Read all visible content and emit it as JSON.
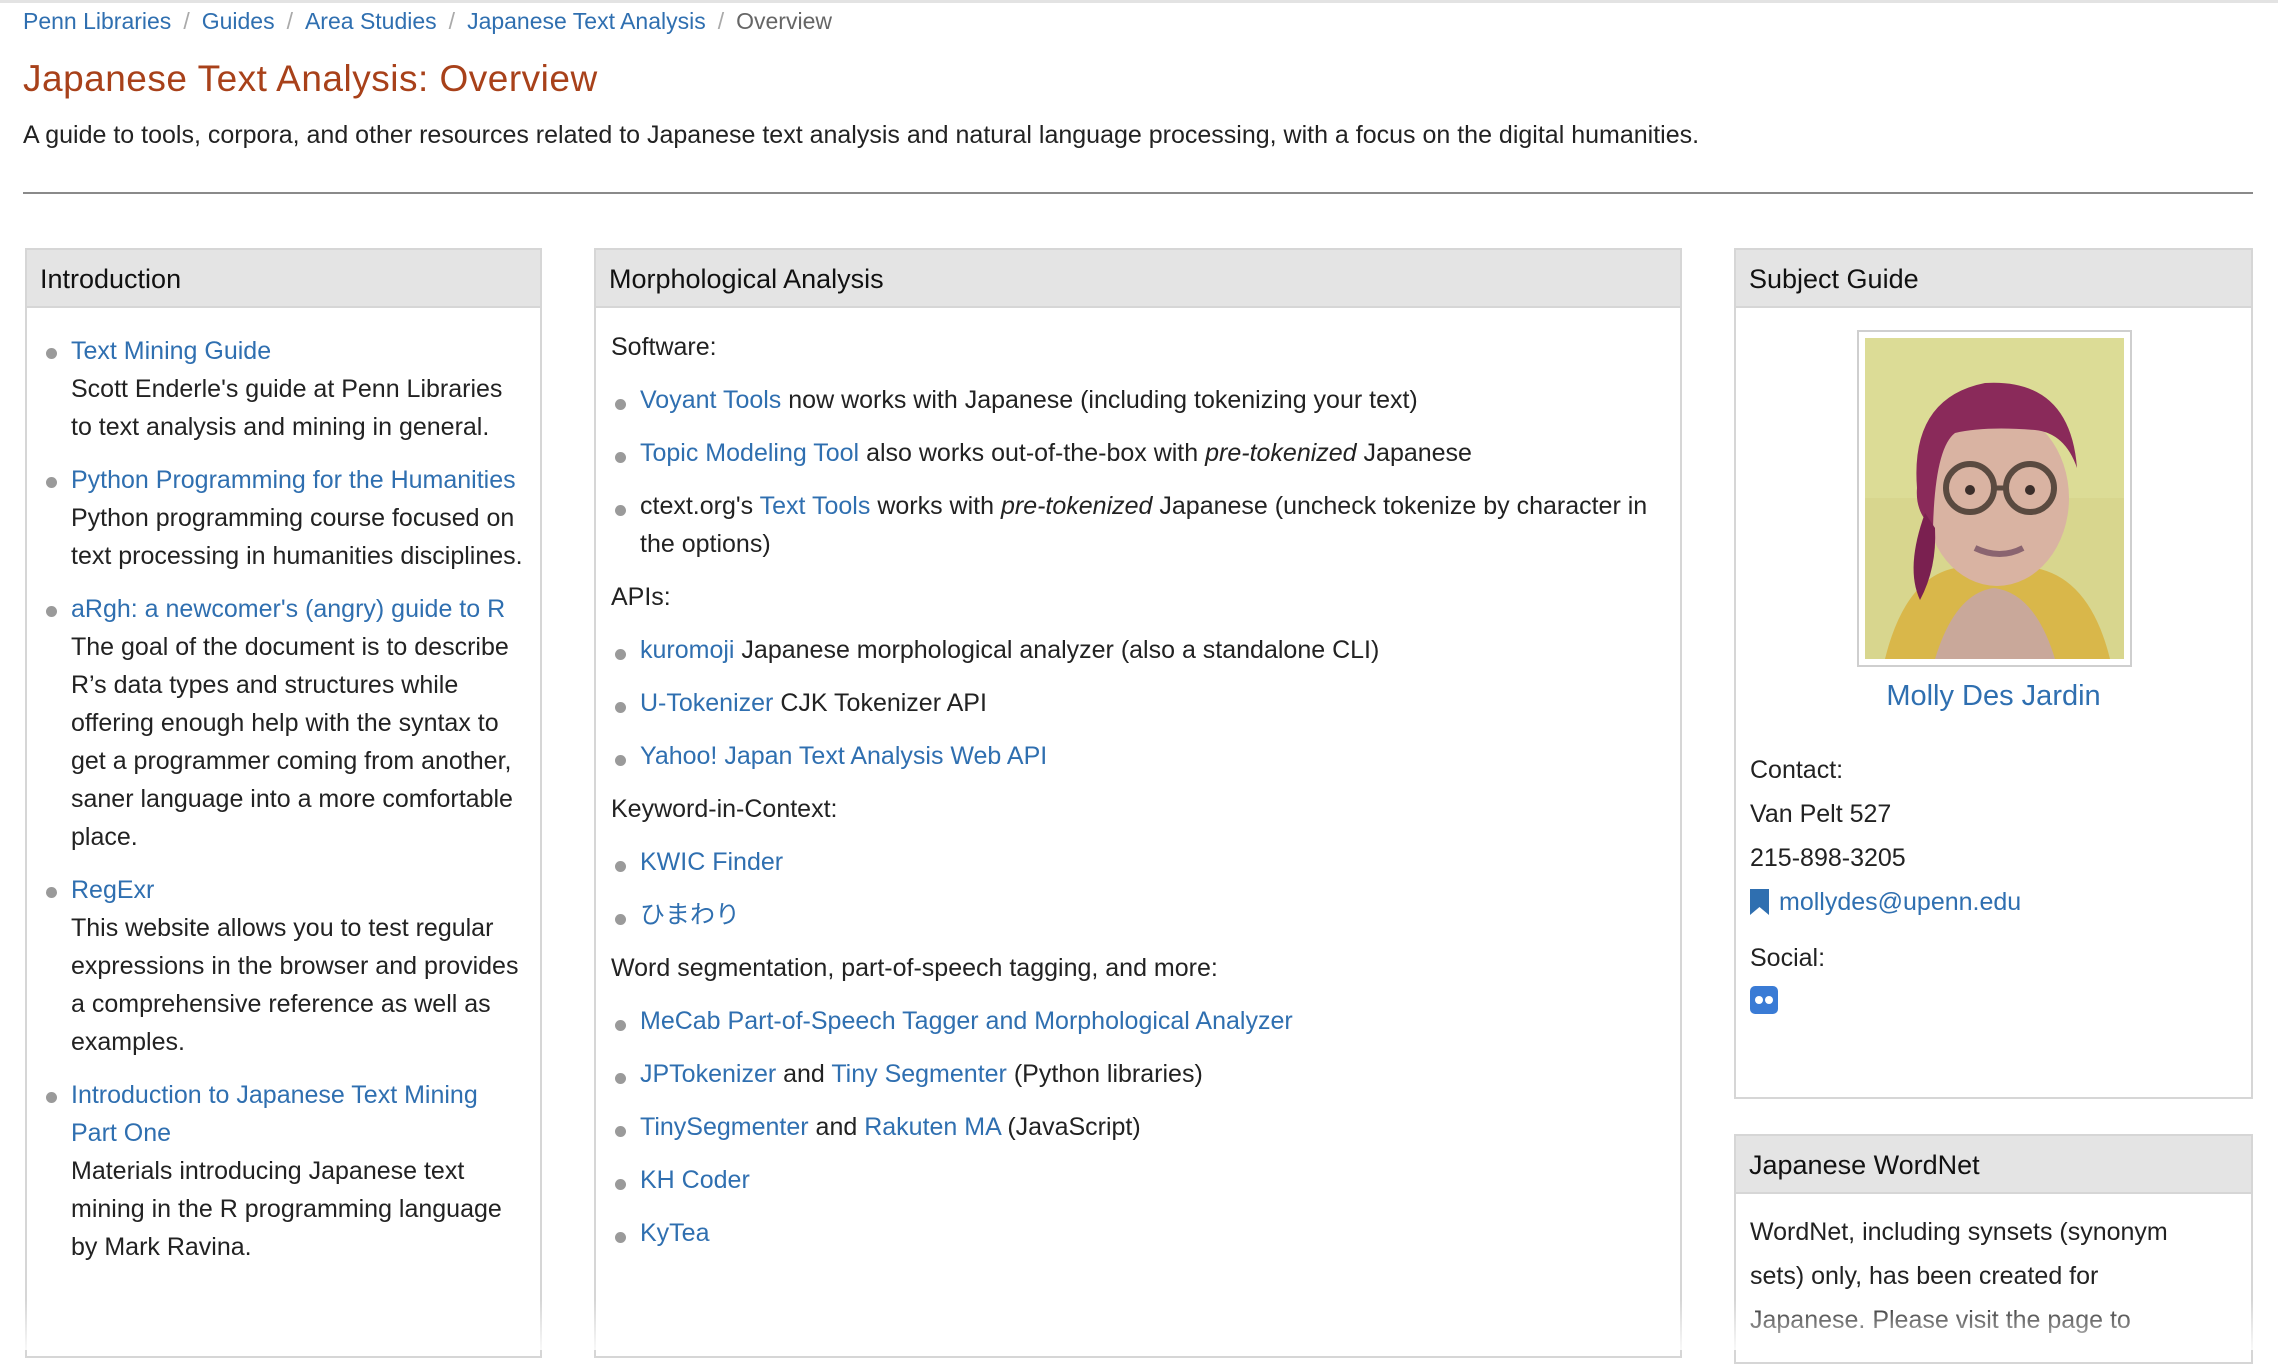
{
  "breadcrumb": {
    "items": [
      "Penn Libraries",
      "Guides",
      "Area Studies",
      "Japanese Text Analysis"
    ],
    "current": "Overview"
  },
  "page": {
    "title": "Japanese Text Analysis: Overview",
    "description": "A guide to tools, corpora, and other resources related to Japanese text analysis and natural language processing, with a focus on the digital humanities."
  },
  "intro": {
    "heading": "Introduction",
    "items": [
      {
        "link": "Text Mining Guide",
        "desc": "Scott Enderle's guide at Penn Libraries to text analysis and mining in general."
      },
      {
        "link": "Python Programming for the Humanities",
        "desc": "Python programming course focused on text processing in humanities disciplines."
      },
      {
        "link": "aRgh: a newcomer's (angry) guide to R",
        "desc": "The goal of the document is to describe R’s data types and structures while offering enough help with the syntax to get a programmer coming from another, saner language into a more comfortable place."
      },
      {
        "link": "RegExr",
        "desc": "This website allows you to test regular expressions in the browser and provides a comprehensive reference as well as examples."
      },
      {
        "link": "Introduction to Japanese Text Mining Part One",
        "desc": "Materials introducing Japanese text mining in the R programming language by Mark Ravina."
      }
    ]
  },
  "morph": {
    "heading": "Morphological Analysis",
    "software_label": "Software:",
    "software": [
      {
        "link": "Voyant Tools",
        "text": " now works with Japanese (including tokenizing your text)"
      },
      {
        "link": "Topic Modeling Tool",
        "text_a": " also works out-of-the-box with ",
        "em": "pre-tokenized",
        "text_b": " Japanese"
      },
      {
        "pre": "ctext.org's ",
        "link": "Text Tools",
        "text_a": " works with ",
        "em": "pre-tokenized",
        "text_b": " Japanese (uncheck tokenize by character in the options)"
      }
    ],
    "apis_label": "APIs:",
    "apis": [
      {
        "link": "kuromoji",
        "text": " Japanese morphological analyzer (also a standalone CLI)"
      },
      {
        "link": "U-Tokenizer",
        "text": " CJK Tokenizer API"
      },
      {
        "link": "Yahoo! Japan Text Analysis Web API",
        "text": ""
      }
    ],
    "kwic_label": "Keyword-in-Context:",
    "kwic": [
      "KWIC Finder",
      "ひまわり"
    ],
    "seg_label": "Word segmentation, part-of-speech tagging, and more:",
    "seg": [
      {
        "link1": "MeCab Part-of-Speech Tagger and Morphological Analyzer"
      },
      {
        "link1": "JPTokenizer",
        "mid": " and ",
        "link2": "Tiny Segmenter",
        "tail": " (Python libraries)"
      },
      {
        "link1": "TinySegmenter",
        "mid": " and ",
        "link2": "Rakuten MA",
        "tail": " (JavaScript)"
      },
      {
        "link1": "KH Coder"
      },
      {
        "link1": "KyTea"
      }
    ]
  },
  "subject": {
    "heading": "Subject Guide",
    "name": "Molly Des Jardin",
    "contact_label": "Contact:",
    "office": "Van Pelt 527",
    "phone": "215-898-3205",
    "email": "mollydes@upenn.edu",
    "social_label": "Social:",
    "social_icon": "flickr-icon"
  },
  "wordnet": {
    "heading": "Japanese WordNet",
    "text_lines": [
      "WordNet, including synsets (synonym",
      "sets) only, has been created for",
      "Japanese. Please visit the page to"
    ]
  }
}
